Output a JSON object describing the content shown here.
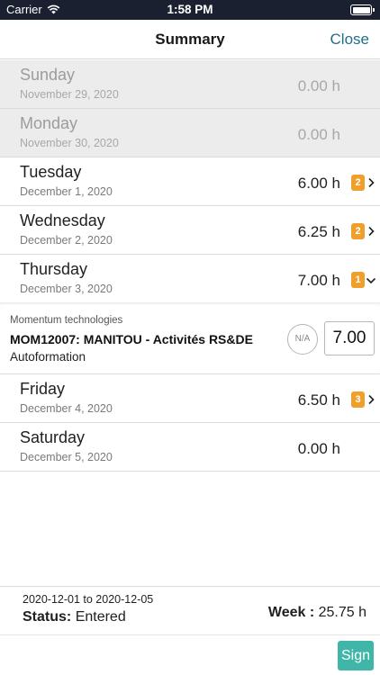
{
  "status_bar": {
    "carrier": "Carrier",
    "time": "1:58 PM"
  },
  "nav": {
    "title": "Summary",
    "close_label": "Close"
  },
  "days": [
    {
      "day": "Sunday",
      "date": "November 29, 2020",
      "hours": "0.00 h",
      "badge": "",
      "disabled": true
    },
    {
      "day": "Monday",
      "date": "November 30, 2020",
      "hours": "0.00 h",
      "badge": "",
      "disabled": true
    },
    {
      "day": "Tuesday",
      "date": "December 1, 2020",
      "hours": "6.00 h",
      "badge": "2",
      "chevron": "right"
    },
    {
      "day": "Wednesday",
      "date": "December 2, 2020",
      "hours": "6.25 h",
      "badge": "2",
      "chevron": "right"
    },
    {
      "day": "Thursday",
      "date": "December 3, 2020",
      "hours": "7.00 h",
      "badge": "1",
      "chevron": "down"
    },
    {
      "day": "Friday",
      "date": "December 4, 2020",
      "hours": "6.50 h",
      "badge": "3",
      "chevron": "right"
    },
    {
      "day": "Saturday",
      "date": "December 5, 2020",
      "hours": "0.00 h",
      "badge": ""
    }
  ],
  "detail": {
    "company": "Momentum technologies",
    "project": "MOM12007: MANITOU - Activités RS&DE",
    "task": "Autoformation",
    "na_label": "N/A",
    "hours_value": "7.00"
  },
  "footer": {
    "range": "2020-12-01 to 2020-12-05",
    "status_label": "Status:",
    "status_value": "Entered",
    "week_label": "Week :",
    "week_value": "25.75 h"
  },
  "sign_label": "Sign",
  "colors": {
    "accent": "#1f6f8b",
    "badge": "#f0a02a",
    "sign": "#3fb6a8",
    "statusbar": "#1a2030"
  }
}
